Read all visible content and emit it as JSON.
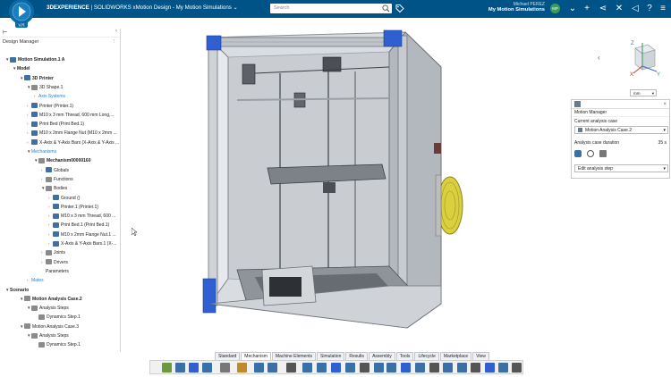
{
  "header": {
    "brand_bold": "3DEXPERIENCE",
    "brand_rest": " | SOLIDWORKS xMotion Design - My Motion Simulations",
    "compass_label": "V.R",
    "search_placeholder": "Search",
    "user_name": "Michael PEREZ",
    "workspace": "My Motion Simulations",
    "avatar_initials": "MP"
  },
  "panel": {
    "title": "Design Manager"
  },
  "tree": [
    {
      "label": "Motion Simulation.1 A",
      "bold": true,
      "exp": "▼",
      "indent": 6,
      "icon": "blue"
    },
    {
      "label": "Model",
      "bold": true,
      "exp": "▼",
      "indent": 14,
      "icon": "none"
    },
    {
      "label": "3D Printer",
      "bold": true,
      "exp": "▼",
      "indent": 22,
      "icon": "blue"
    },
    {
      "label": "3D Shape.1",
      "exp": "▼",
      "indent": 30,
      "icon": "gray"
    },
    {
      "label": "Axis Systems",
      "link": true,
      "exp": "›",
      "indent": 38,
      "icon": "none"
    },
    {
      "label": "Printer (Printer.1)",
      "exp": "›",
      "indent": 30,
      "icon": "blue"
    },
    {
      "label": "M10 x 3 mm Thread, 600 mm Long,...",
      "exp": "›",
      "indent": 30,
      "icon": "blue"
    },
    {
      "label": "Print Bed (Print Bed.1)",
      "exp": "›",
      "indent": 30,
      "icon": "blue"
    },
    {
      "label": "M10 x 2mm Flange Nut (M10 x 2mm ...",
      "exp": "›",
      "indent": 30,
      "icon": "blue"
    },
    {
      "label": "X-Axis & Y-Axis Bars (X-Axis & Y-Axis ...",
      "exp": "›",
      "indent": 30,
      "icon": "blue"
    },
    {
      "label": "Mechanisms",
      "link": true,
      "exp": "▼",
      "indent": 30,
      "icon": "none"
    },
    {
      "label": "Mechanism00000160",
      "bold": true,
      "exp": "▼",
      "indent": 38,
      "icon": "gray"
    },
    {
      "label": "Globals",
      "exp": "›",
      "indent": 46,
      "icon": "blue"
    },
    {
      "label": "Functions",
      "exp": "›",
      "indent": 46,
      "icon": "gray"
    },
    {
      "label": "Bodies",
      "exp": "▼",
      "indent": 46,
      "icon": "gray"
    },
    {
      "label": "Ground ()",
      "exp": "›",
      "indent": 54,
      "icon": "blue"
    },
    {
      "label": "Printer.1 (Printer.1)",
      "exp": "›",
      "indent": 54,
      "icon": "blue"
    },
    {
      "label": "M10 x 3 mm Thread, 600 ...",
      "exp": "›",
      "indent": 54,
      "icon": "blue"
    },
    {
      "label": "Print Bed.1 (Print Bed.1)",
      "exp": "›",
      "indent": 54,
      "icon": "blue"
    },
    {
      "label": "M10 x 2mm Flange Nut.1 ...",
      "exp": "›",
      "indent": 54,
      "icon": "blue"
    },
    {
      "label": "X-Axis & Y-Axis Bars.1 (X-...",
      "exp": "›",
      "indent": 54,
      "icon": "blue"
    },
    {
      "label": "Joints",
      "exp": "›",
      "indent": 46,
      "icon": "gray"
    },
    {
      "label": "Drivers",
      "exp": "›",
      "indent": 46,
      "icon": "gray"
    },
    {
      "label": "Parameters",
      "exp": "",
      "indent": 46,
      "icon": "none"
    },
    {
      "label": "Mates",
      "link": true,
      "exp": "›",
      "indent": 30,
      "icon": "none"
    },
    {
      "label": "Scenario",
      "bold": true,
      "exp": "▼",
      "indent": 6,
      "icon": "none"
    },
    {
      "label": "Motion Analysis Case.2",
      "bold": true,
      "exp": "▼",
      "indent": 22,
      "icon": "gray"
    },
    {
      "label": "Analysis Steps",
      "exp": "▼",
      "indent": 30,
      "icon": "gray"
    },
    {
      "label": "Dynamics Step.1",
      "exp": "",
      "indent": 38,
      "icon": "gray"
    },
    {
      "label": "Motion Analysis Case.3",
      "exp": "▼",
      "indent": 22,
      "icon": "gray"
    },
    {
      "label": "Analysis Steps",
      "exp": "▼",
      "indent": 30,
      "icon": "gray"
    },
    {
      "label": "Dynamics Step.1",
      "exp": "",
      "indent": 38,
      "icon": "gray"
    }
  ],
  "units": "mm",
  "axes": {
    "x": "X",
    "y": "Y",
    "z": "Z"
  },
  "motion_manager": {
    "title": "Motion Manager",
    "current_case_label": "Current analysis case",
    "current_case_value": "Motion Analysis Case.2",
    "duration_label": "Analysis case duration",
    "duration_value": "35 s",
    "edit_step": "Edit analysis step"
  },
  "tabs": [
    "Standard",
    "Mechanism",
    "Machine Elements",
    "Simulation",
    "Results",
    "Assembly",
    "Tools",
    "Lifecycle",
    "Marketplace",
    "View"
  ],
  "active_tab": "Mechanism",
  "colors": {
    "header": "#005386",
    "accent_blue": "#2f5fd0",
    "spool_yellow": "#e2d84a"
  }
}
